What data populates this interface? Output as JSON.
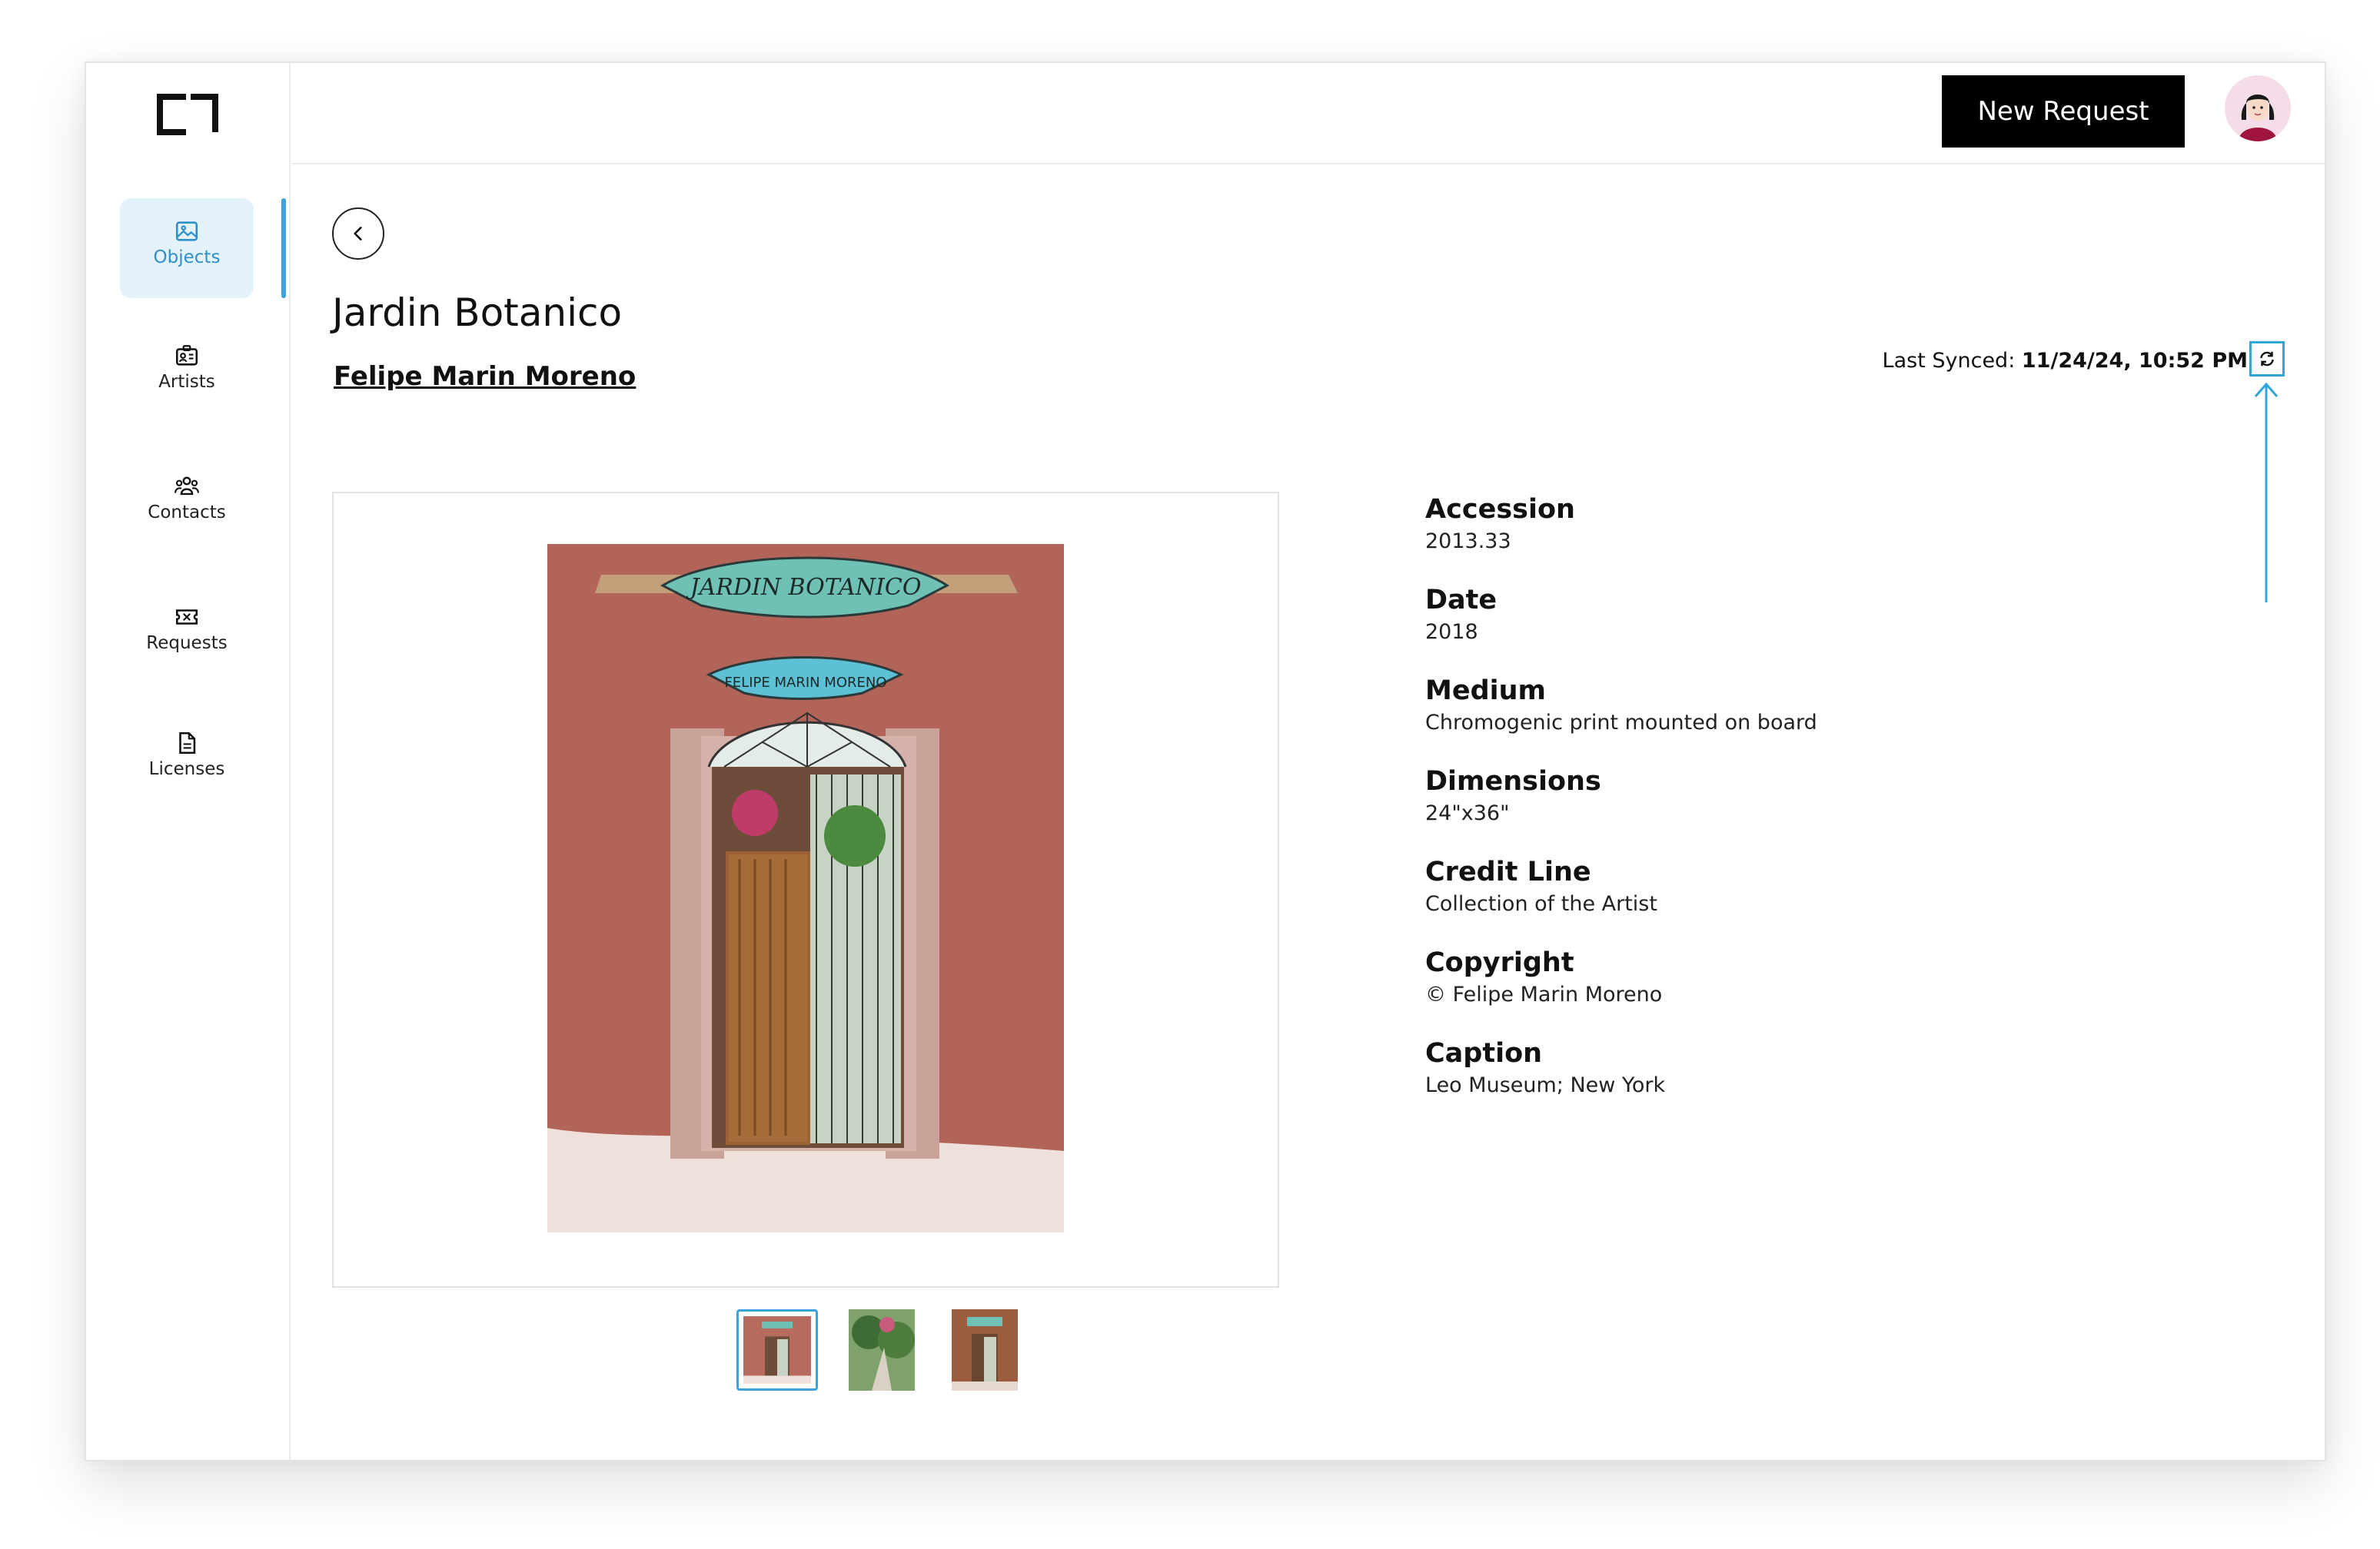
{
  "sidebar": {
    "items": [
      {
        "label": "Objects",
        "icon": "image-icon"
      },
      {
        "label": "Artists",
        "icon": "id-card-icon"
      },
      {
        "label": "Contacts",
        "icon": "users-icon"
      },
      {
        "label": "Requests",
        "icon": "ticket-icon"
      },
      {
        "label": "Licenses",
        "icon": "document-icon"
      }
    ]
  },
  "header": {
    "new_request_label": "New Request"
  },
  "object": {
    "title": "Jardin Botanico",
    "artist": "Felipe Marin Moreno",
    "sync_label": "Last Synced:",
    "sync_time": "11/24/24, 10:52 PM",
    "fields": [
      {
        "label": "Accession",
        "value": "2013.33"
      },
      {
        "label": "Date",
        "value": "2018"
      },
      {
        "label": "Medium",
        "value": "Chromogenic print mounted on board"
      },
      {
        "label": "Dimensions",
        "value": "24\"x36\""
      },
      {
        "label": "Credit Line",
        "value": "Collection of the Artist"
      },
      {
        "label": "Copyright",
        "value": "© Felipe Marin Moreno"
      },
      {
        "label": "Caption",
        "value": "Leo Museum; New York"
      }
    ]
  },
  "colors": {
    "accent": "#3aa2dc",
    "active_bg": "#e3f2fb",
    "button_bg": "#000000"
  }
}
